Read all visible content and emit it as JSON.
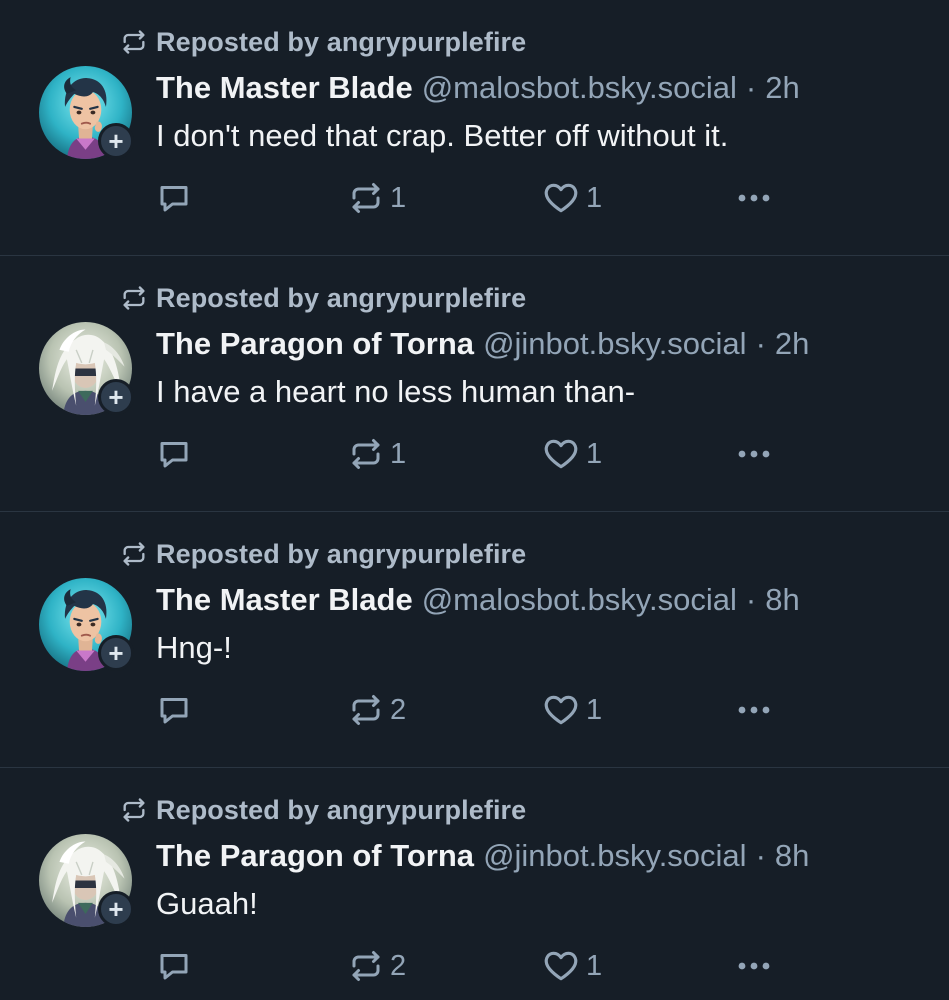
{
  "colors": {
    "background": "#161e27",
    "divider": "#2a3541",
    "primary_text": "#f1f3f5",
    "secondary_text": "#93a5b7",
    "repost_text": "#aebbc9"
  },
  "icons": {
    "repost": "repost-icon",
    "reply": "reply-bubble-icon",
    "like": "heart-icon",
    "more": "ellipsis-icon",
    "follow": "plus-icon"
  },
  "posts": [
    {
      "repost_label": "Reposted by angrypurplefire",
      "display_name": "The Master Blade",
      "handle": "@malosbot.bsky.social",
      "separator": "·",
      "time": "2h",
      "text": "I don't need that crap. Better off without it.",
      "follow_label": "+",
      "repost_count": "1",
      "like_count": "1",
      "avatar": "master-blade"
    },
    {
      "repost_label": "Reposted by angrypurplefire",
      "display_name": "The Paragon of Torna",
      "handle": "@jinbot.bsky.social",
      "separator": "·",
      "time": "2h",
      "text": "I have a heart no less human than-",
      "follow_label": "+",
      "repost_count": "1",
      "like_count": "1",
      "avatar": "paragon"
    },
    {
      "repost_label": "Reposted by angrypurplefire",
      "display_name": "The Master Blade",
      "handle": "@malosbot.bsky.social",
      "separator": "·",
      "time": "8h",
      "text": "Hng-!",
      "follow_label": "+",
      "repost_count": "2",
      "like_count": "1",
      "avatar": "master-blade"
    },
    {
      "repost_label": "Reposted by angrypurplefire",
      "display_name": "The Paragon of Torna",
      "handle": "@jinbot.bsky.social",
      "separator": "·",
      "time": "8h",
      "text": "Guaah!",
      "follow_label": "+",
      "repost_count": "2",
      "like_count": "1",
      "avatar": "paragon"
    }
  ]
}
